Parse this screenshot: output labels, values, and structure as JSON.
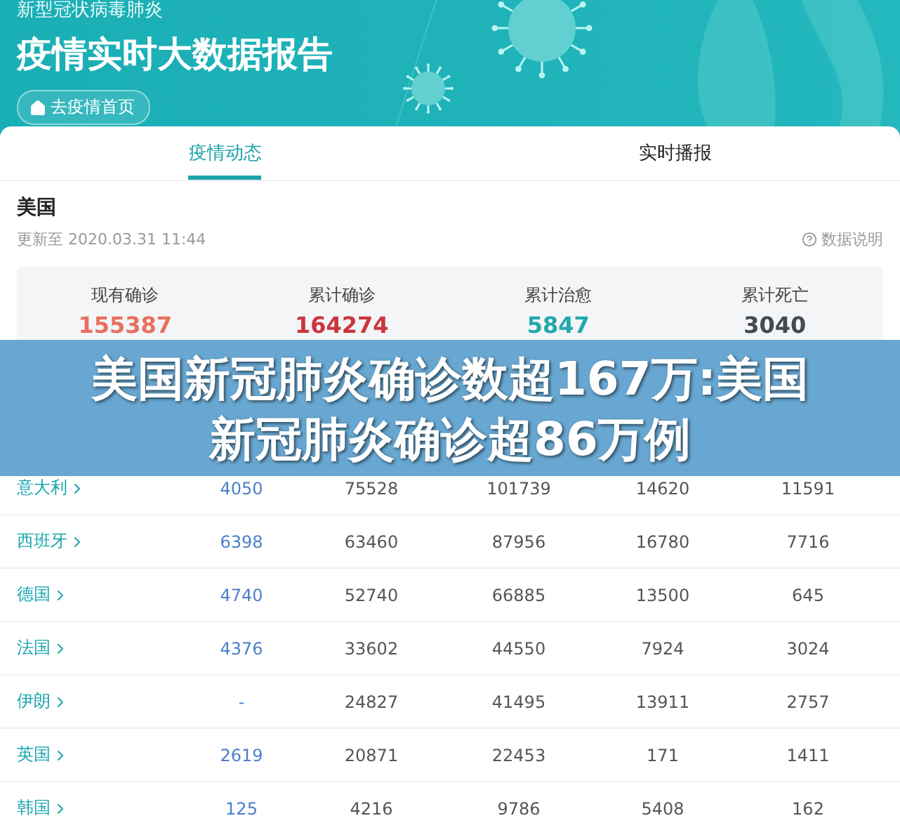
{
  "header": {
    "subtitle": "新型冠状病毒肺炎",
    "title": "疫情实时大数据报告",
    "home_button": "去疫情首页"
  },
  "tabs": [
    {
      "label": "疫情动态",
      "selected": true
    },
    {
      "label": "实时播报",
      "selected": false
    }
  ],
  "region": {
    "name": "美国",
    "updated": "更新至 2020.03.31 11:44",
    "help_link": "数据说明"
  },
  "stats": [
    {
      "label": "现有确诊",
      "value": "155387",
      "color": "#e8705f"
    },
    {
      "label": "累计确诊",
      "value": "164274",
      "color": "#c9363c"
    },
    {
      "label": "累计治愈",
      "value": "5847",
      "color": "#22a8ac"
    },
    {
      "label": "累计死亡",
      "value": "3040",
      "color": "#444a52"
    }
  ],
  "table": {
    "rows": [
      {
        "country": "意大利",
        "cells": [
          "4050",
          "75528",
          "101739",
          "14620",
          "11591"
        ]
      },
      {
        "country": "西班牙",
        "cells": [
          "6398",
          "63460",
          "87956",
          "16780",
          "7716"
        ]
      },
      {
        "country": "德国",
        "cells": [
          "4740",
          "52740",
          "66885",
          "13500",
          "645"
        ]
      },
      {
        "country": "法国",
        "cells": [
          "4376",
          "33602",
          "44550",
          "7924",
          "3024"
        ]
      },
      {
        "country": "伊朗",
        "cells": [
          "-",
          "24827",
          "41495",
          "13911",
          "2757"
        ]
      },
      {
        "country": "英国",
        "cells": [
          "2619",
          "20871",
          "22453",
          "171",
          "1411"
        ]
      },
      {
        "country": "韩国",
        "cells": [
          "125",
          "4216",
          "9786",
          "5408",
          "162"
        ]
      }
    ]
  },
  "banner": {
    "headline": "美国新冠肺炎确诊数超167万:美国新冠肺炎确诊超86万例"
  }
}
